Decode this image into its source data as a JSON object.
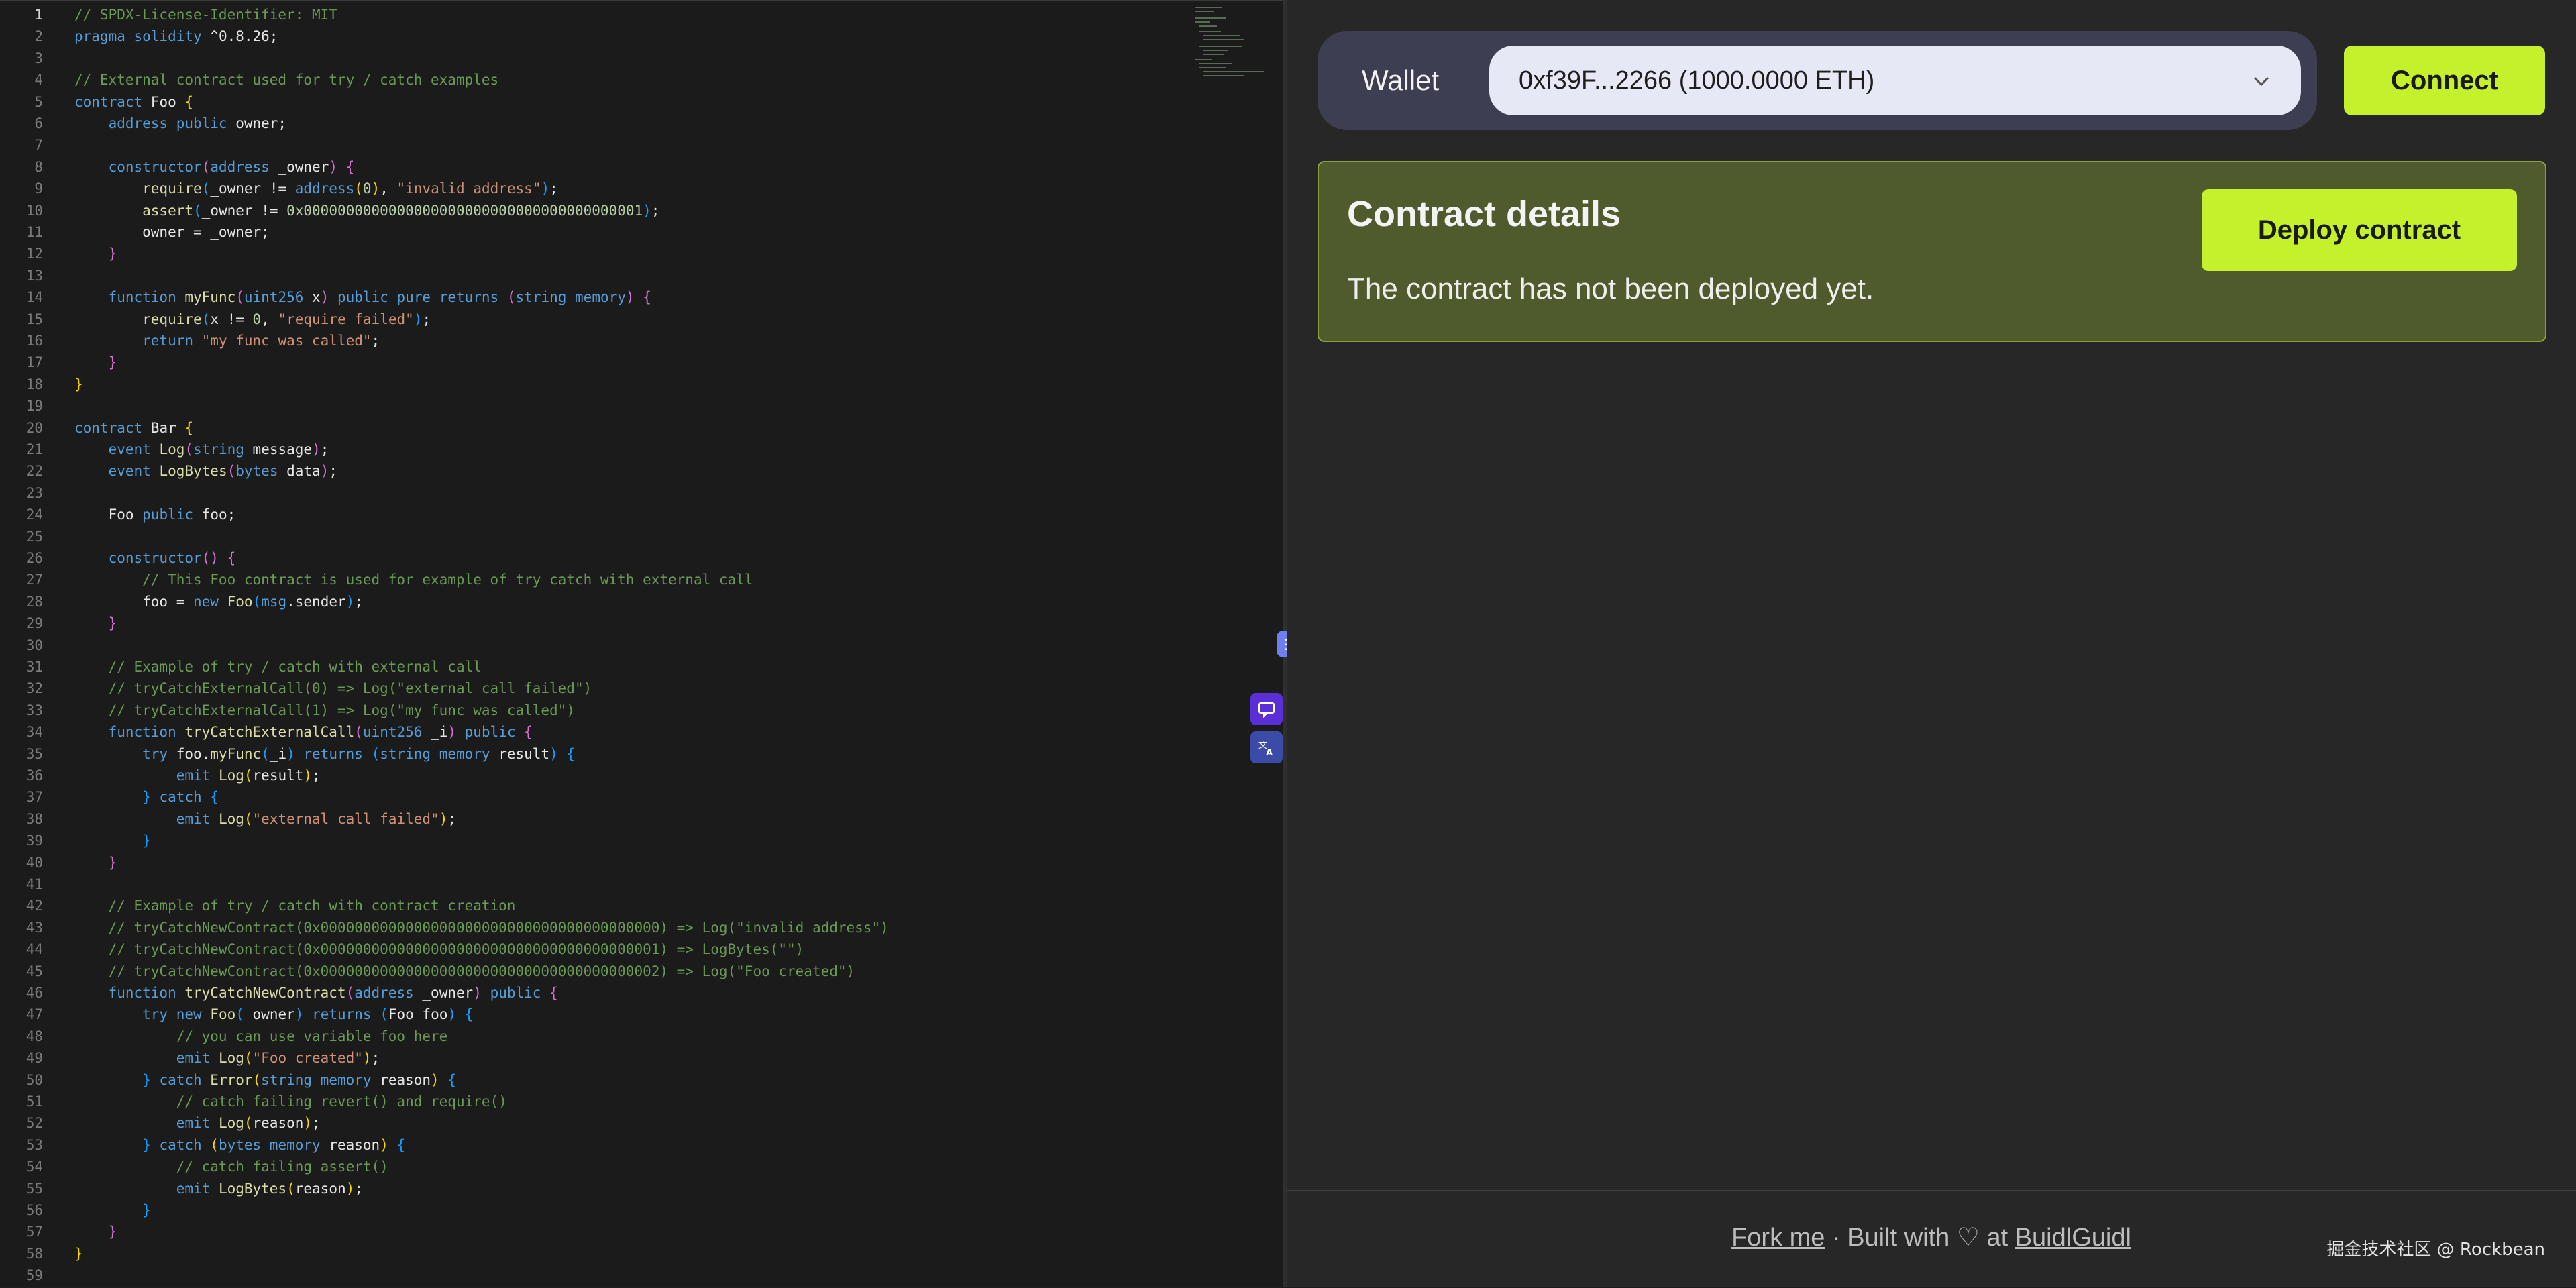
{
  "editor": {
    "current_line": 1,
    "lines": [
      [
        [
          "// SPDX-License-Identifier: MIT",
          "com"
        ]
      ],
      [
        [
          "pragma solidity ",
          "kw"
        ],
        [
          "^0.8.26;",
          "id"
        ]
      ],
      [],
      [
        [
          "// External contract used for try / catch examples",
          "com"
        ]
      ],
      [
        [
          "contract ",
          "kw"
        ],
        [
          "Foo ",
          "id"
        ],
        [
          "{",
          "b1"
        ]
      ],
      [
        [
          "    address public ",
          "kw"
        ],
        [
          "owner;",
          "id"
        ]
      ],
      [],
      [
        [
          "    constructor",
          "kw"
        ],
        [
          "(",
          "b2"
        ],
        [
          "address ",
          "kw"
        ],
        [
          "_owner",
          "id"
        ],
        [
          ") ",
          "b2"
        ],
        [
          "{",
          "b2"
        ]
      ],
      [
        [
          "        require",
          "fn"
        ],
        [
          "(",
          "b3"
        ],
        [
          "_owner != ",
          "id"
        ],
        [
          "address",
          "kw"
        ],
        [
          "(",
          "b1"
        ],
        [
          "0",
          "num"
        ],
        [
          ")",
          "b1"
        ],
        [
          ", ",
          "id"
        ],
        [
          "\"invalid address\"",
          "str"
        ],
        [
          ")",
          "b3"
        ],
        [
          ";",
          "id"
        ]
      ],
      [
        [
          "        assert",
          "fn"
        ],
        [
          "(",
          "b3"
        ],
        [
          "_owner != ",
          "id"
        ],
        [
          "0x0000000000000000000000000000000000000001",
          "num"
        ],
        [
          ")",
          "b3"
        ],
        [
          ";",
          "id"
        ]
      ],
      [
        [
          "        owner = _owner;",
          "id"
        ]
      ],
      [
        [
          "    }",
          "b2"
        ]
      ],
      [],
      [
        [
          "    function ",
          "kw"
        ],
        [
          "myFunc",
          "fn"
        ],
        [
          "(",
          "b2"
        ],
        [
          "uint256 ",
          "kw"
        ],
        [
          "x",
          "id"
        ],
        [
          ") ",
          "b2"
        ],
        [
          "public pure returns ",
          "kw"
        ],
        [
          "(",
          "b2"
        ],
        [
          "string memory",
          "kw"
        ],
        [
          ") ",
          "b2"
        ],
        [
          "{",
          "b2"
        ]
      ],
      [
        [
          "        require",
          "fn"
        ],
        [
          "(",
          "b3"
        ],
        [
          "x != ",
          "id"
        ],
        [
          "0",
          "num"
        ],
        [
          ", ",
          "id"
        ],
        [
          "\"require failed\"",
          "str"
        ],
        [
          ")",
          "b3"
        ],
        [
          ";",
          "id"
        ]
      ],
      [
        [
          "        return ",
          "kw"
        ],
        [
          "\"my func was called\"",
          "str"
        ],
        [
          ";",
          "id"
        ]
      ],
      [
        [
          "    }",
          "b2"
        ]
      ],
      [
        [
          "}",
          "b1"
        ]
      ],
      [],
      [
        [
          "contract ",
          "kw"
        ],
        [
          "Bar ",
          "id"
        ],
        [
          "{",
          "b1"
        ]
      ],
      [
        [
          "    event ",
          "kw"
        ],
        [
          "Log",
          "fn"
        ],
        [
          "(",
          "b2"
        ],
        [
          "string ",
          "kw"
        ],
        [
          "message",
          "id"
        ],
        [
          ")",
          "b2"
        ],
        [
          ";",
          "id"
        ]
      ],
      [
        [
          "    event ",
          "kw"
        ],
        [
          "LogBytes",
          "fn"
        ],
        [
          "(",
          "b2"
        ],
        [
          "bytes ",
          "kw"
        ],
        [
          "data",
          "id"
        ],
        [
          ")",
          "b2"
        ],
        [
          ";",
          "id"
        ]
      ],
      [],
      [
        [
          "    Foo ",
          "id"
        ],
        [
          "public ",
          "kw"
        ],
        [
          "foo;",
          "id"
        ]
      ],
      [],
      [
        [
          "    constructor",
          "kw"
        ],
        [
          "() ",
          "b2"
        ],
        [
          "{",
          "b2"
        ]
      ],
      [
        [
          "        // This Foo contract is used for example of try catch with external call",
          "com"
        ]
      ],
      [
        [
          "        foo = ",
          "id"
        ],
        [
          "new ",
          "kw"
        ],
        [
          "Foo",
          "fn"
        ],
        [
          "(",
          "b3"
        ],
        [
          "msg",
          "kw"
        ],
        [
          ".sender",
          "id"
        ],
        [
          ")",
          "b3"
        ],
        [
          ";",
          "id"
        ]
      ],
      [
        [
          "    }",
          "b2"
        ]
      ],
      [],
      [
        [
          "    // Example of try / catch with external call",
          "com"
        ]
      ],
      [
        [
          "    // tryCatchExternalCall(0) => Log(\"external call failed\")",
          "com"
        ]
      ],
      [
        [
          "    // tryCatchExternalCall(1) => Log(\"my func was called\")",
          "com"
        ]
      ],
      [
        [
          "    function ",
          "kw"
        ],
        [
          "tryCatchExternalCall",
          "fn"
        ],
        [
          "(",
          "b2"
        ],
        [
          "uint256 ",
          "kw"
        ],
        [
          "_i",
          "id"
        ],
        [
          ") ",
          "b2"
        ],
        [
          "public ",
          "kw"
        ],
        [
          "{",
          "b2"
        ]
      ],
      [
        [
          "        try ",
          "kw"
        ],
        [
          "foo.",
          "id"
        ],
        [
          "myFunc",
          "fn"
        ],
        [
          "(",
          "b3"
        ],
        [
          "_i",
          "id"
        ],
        [
          ") ",
          "b3"
        ],
        [
          "returns ",
          "kw"
        ],
        [
          "(",
          "b3"
        ],
        [
          "string memory ",
          "kw"
        ],
        [
          "result",
          "id"
        ],
        [
          ") ",
          "b3"
        ],
        [
          "{",
          "b3"
        ]
      ],
      [
        [
          "            emit ",
          "kw"
        ],
        [
          "Log",
          "fn"
        ],
        [
          "(",
          "b1"
        ],
        [
          "result",
          "id"
        ],
        [
          ")",
          "b1"
        ],
        [
          ";",
          "id"
        ]
      ],
      [
        [
          "        } ",
          "b3"
        ],
        [
          "catch ",
          "kw"
        ],
        [
          "{",
          "b3"
        ]
      ],
      [
        [
          "            emit ",
          "kw"
        ],
        [
          "Log",
          "fn"
        ],
        [
          "(",
          "b1"
        ],
        [
          "\"external call failed\"",
          "str"
        ],
        [
          ")",
          "b1"
        ],
        [
          ";",
          "id"
        ]
      ],
      [
        [
          "        }",
          "b3"
        ]
      ],
      [
        [
          "    }",
          "b2"
        ]
      ],
      [],
      [
        [
          "    // Example of try / catch with contract creation",
          "com"
        ]
      ],
      [
        [
          "    // tryCatchNewContract(0x0000000000000000000000000000000000000000) => Log(\"invalid address\")",
          "com"
        ]
      ],
      [
        [
          "    // tryCatchNewContract(0x0000000000000000000000000000000000000001) => LogBytes(\"\")",
          "com"
        ]
      ],
      [
        [
          "    // tryCatchNewContract(0x0000000000000000000000000000000000000002) => Log(\"Foo created\")",
          "com"
        ]
      ],
      [
        [
          "    function ",
          "kw"
        ],
        [
          "tryCatchNewContract",
          "fn"
        ],
        [
          "(",
          "b2"
        ],
        [
          "address ",
          "kw"
        ],
        [
          "_owner",
          "id"
        ],
        [
          ") ",
          "b2"
        ],
        [
          "public ",
          "kw"
        ],
        [
          "{",
          "b2"
        ]
      ],
      [
        [
          "        try ",
          "kw"
        ],
        [
          "new ",
          "kw"
        ],
        [
          "Foo",
          "fn"
        ],
        [
          "(",
          "b3"
        ],
        [
          "_owner",
          "id"
        ],
        [
          ") ",
          "b3"
        ],
        [
          "returns ",
          "kw"
        ],
        [
          "(",
          "b3"
        ],
        [
          "Foo foo",
          "id"
        ],
        [
          ") ",
          "b3"
        ],
        [
          "{",
          "b3"
        ]
      ],
      [
        [
          "            // you can use variable foo here",
          "com"
        ]
      ],
      [
        [
          "            emit ",
          "kw"
        ],
        [
          "Log",
          "fn"
        ],
        [
          "(",
          "b1"
        ],
        [
          "\"Foo created\"",
          "str"
        ],
        [
          ")",
          "b1"
        ],
        [
          ";",
          "id"
        ]
      ],
      [
        [
          "        } ",
          "b3"
        ],
        [
          "catch ",
          "kw"
        ],
        [
          "Error",
          "fn"
        ],
        [
          "(",
          "b1"
        ],
        [
          "string memory ",
          "kw"
        ],
        [
          "reason",
          "id"
        ],
        [
          ") ",
          "b1"
        ],
        [
          "{",
          "b3"
        ]
      ],
      [
        [
          "            // catch failing revert() and require()",
          "com"
        ]
      ],
      [
        [
          "            emit ",
          "kw"
        ],
        [
          "Log",
          "fn"
        ],
        [
          "(",
          "b1"
        ],
        [
          "reason",
          "id"
        ],
        [
          ")",
          "b1"
        ],
        [
          ";",
          "id"
        ]
      ],
      [
        [
          "        } ",
          "b3"
        ],
        [
          "catch ",
          "kw"
        ],
        [
          "(",
          "b1"
        ],
        [
          "bytes memory ",
          "kw"
        ],
        [
          "reason",
          "id"
        ],
        [
          ") ",
          "b1"
        ],
        [
          "{",
          "b3"
        ]
      ],
      [
        [
          "            // catch failing assert()",
          "com"
        ]
      ],
      [
        [
          "            emit ",
          "kw"
        ],
        [
          "LogBytes",
          "fn"
        ],
        [
          "(",
          "b1"
        ],
        [
          "reason",
          "id"
        ],
        [
          ")",
          "b1"
        ],
        [
          ";",
          "id"
        ]
      ],
      [
        [
          "        }",
          "b3"
        ]
      ],
      [
        [
          "    }",
          "b2"
        ]
      ],
      [
        [
          "}",
          "b1"
        ]
      ],
      []
    ]
  },
  "wallet": {
    "label": "Wallet",
    "selected": "0xf39F...2266 (1000.0000 ETH)",
    "chevron_icon": "chevron-down-icon"
  },
  "connect": {
    "label": "Connect"
  },
  "contract_details": {
    "title": "Contract details",
    "message": "The contract has not been deployed yet.",
    "deploy_label": "Deploy contract"
  },
  "footer": {
    "fork_link": "Fork me",
    "sep": " · Built with ",
    "heart_icon": "♡",
    "at": " at ",
    "buidl_link": "BuidlGuidl"
  },
  "watermark": "掘金技术社区 @ Rockbean",
  "colors": {
    "accent": "#c5f12c",
    "card_bg": "#4f5b2d",
    "wallet_bg": "#3d3e51"
  }
}
